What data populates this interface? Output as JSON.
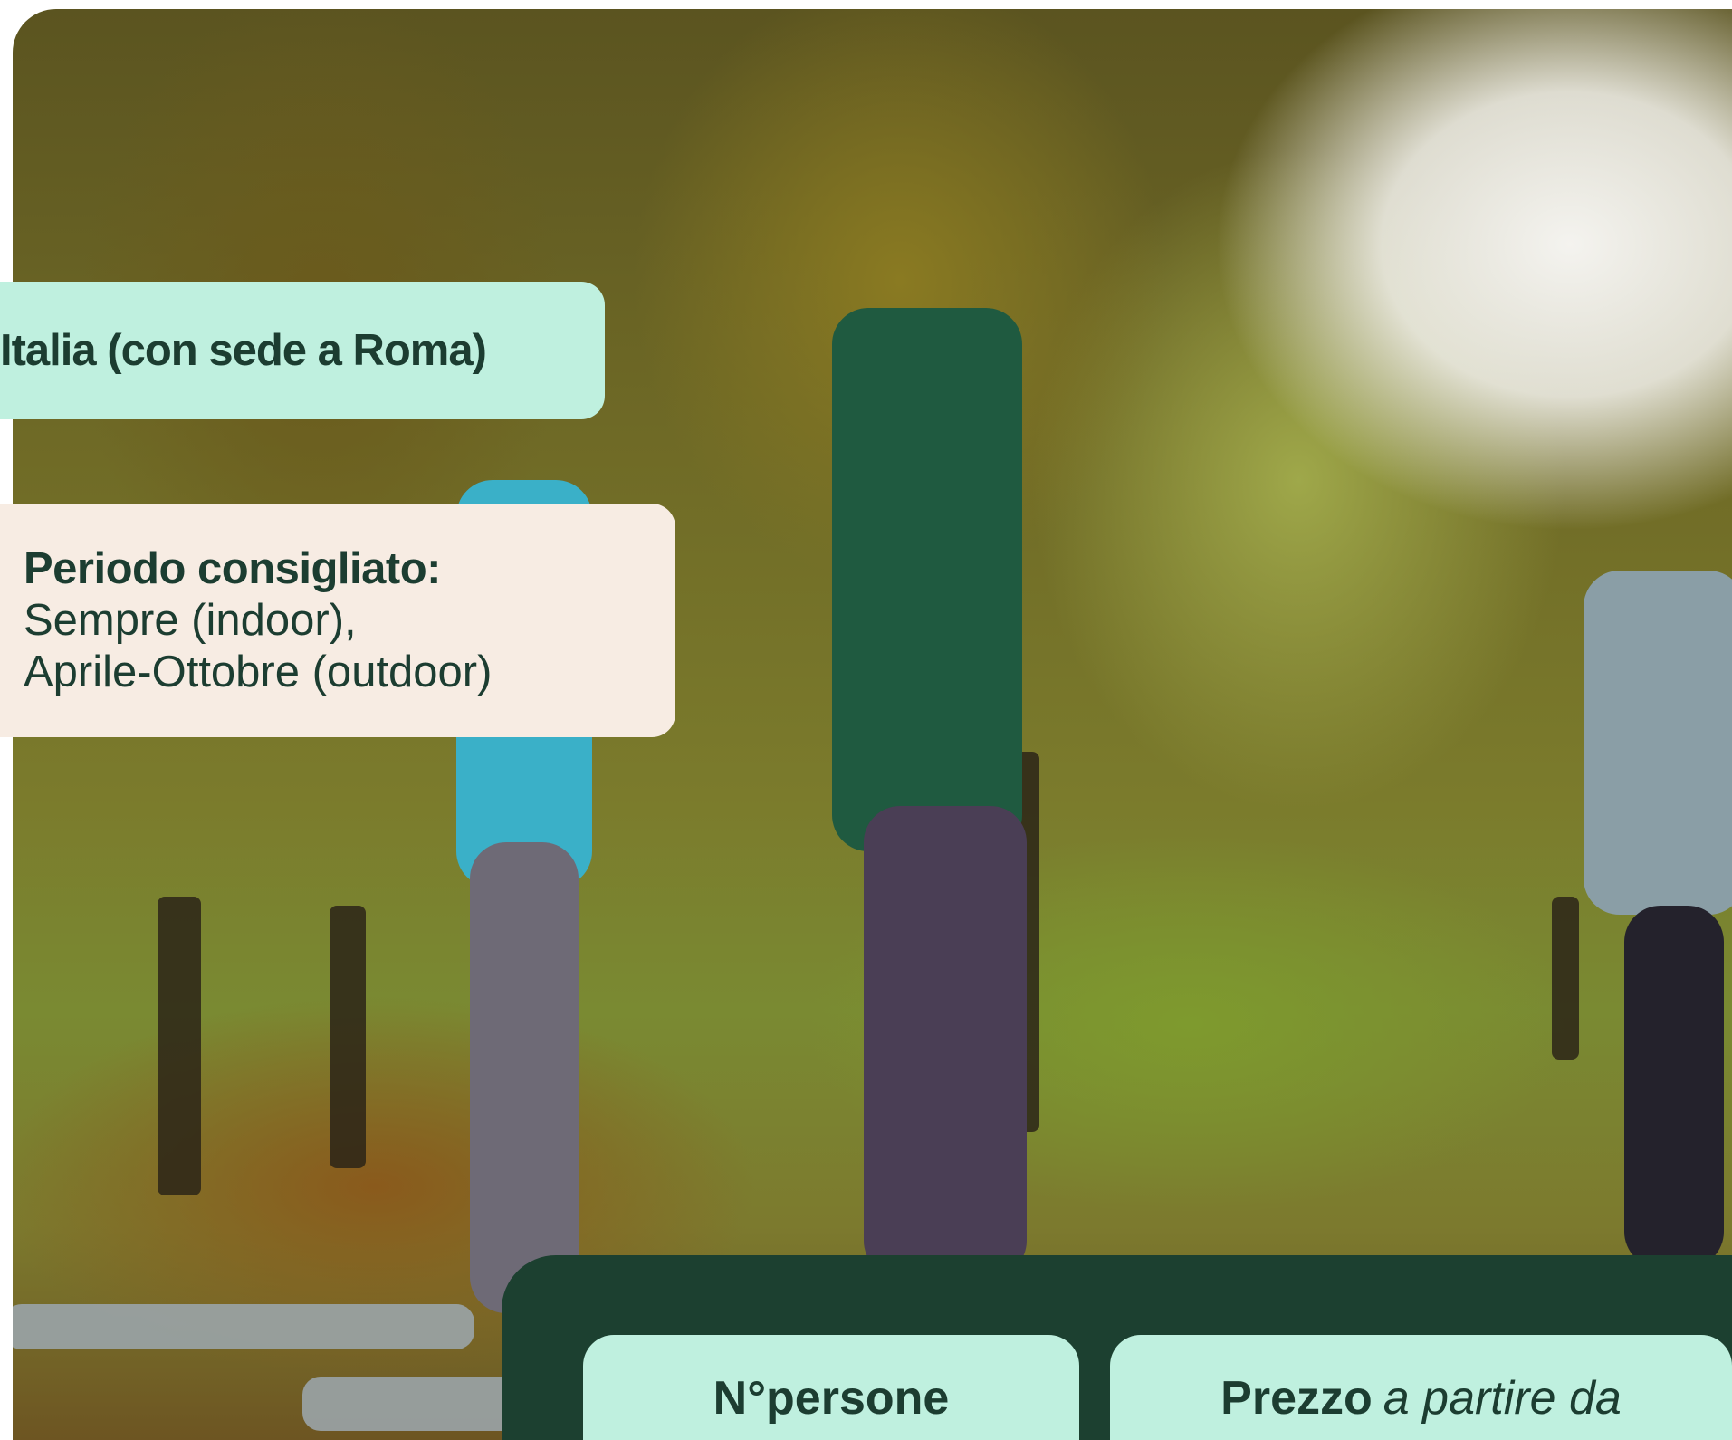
{
  "location_tag": {
    "text": "Italia (con sede a Roma)"
  },
  "period_tag": {
    "label": "Periodo consigliato:",
    "line1": "Sempre (indoor),",
    "line2": "Aprile-Ottobre (outdoor)"
  },
  "info_panel": {
    "persons_label": "N°persone",
    "price_label": "Prezzo",
    "price_suffix": "a partire da"
  },
  "colors": {
    "dark_green": "#1c4030",
    "mint": "#bff0df",
    "cream": "#f7ece3",
    "text_green": "#1c3d31"
  }
}
